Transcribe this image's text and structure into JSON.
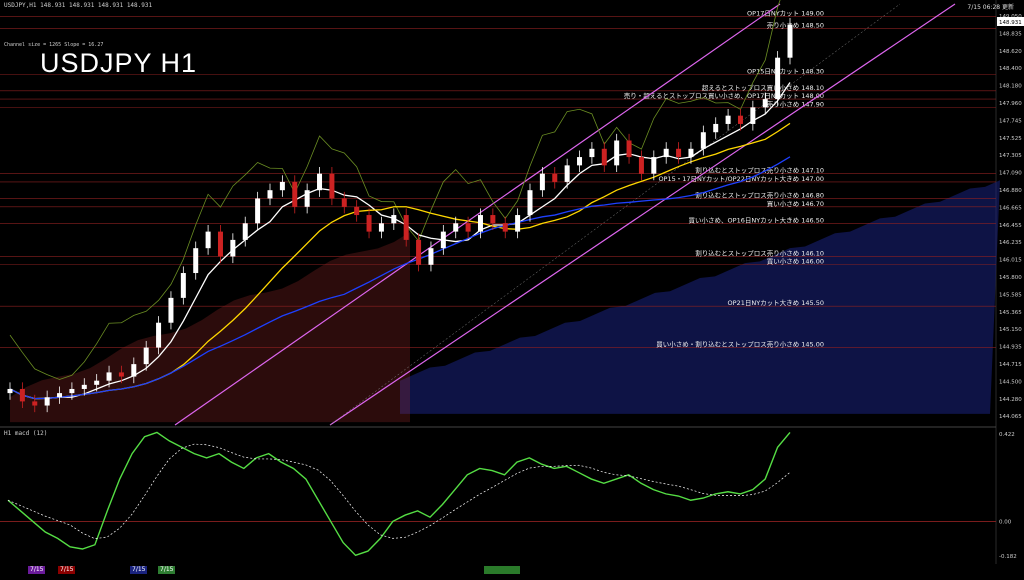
{
  "header": {
    "symbol_line": "USDJPY,H1  148.931 148.931 148.931 148.931",
    "channel_info": "Channel size = 1265 Slope = 16.27",
    "title": "USDJPY H1",
    "timestamp": "7/15 06:28 更新"
  },
  "macd_label": "H1  macd (12)",
  "bottom_tabs": [
    {
      "label": "7/15",
      "color": "#6a1b9a"
    },
    {
      "label": "7/15",
      "color": "#8b0000"
    },
    {
      "label": "7/15",
      "color": "#1a237e"
    },
    {
      "label": "7/15",
      "color": "#2e7d32"
    }
  ],
  "colors": {
    "candle_up": "#ffffff",
    "candle_down": "#cc2222",
    "ma_short": "#ffffff",
    "ma_mid": "#ffd700",
    "ma_long": "#1e40ff",
    "channel": "#dd66ee",
    "ichimoku_span": "#6b8e23",
    "level_line": "#8b2020",
    "macd_main": "#55dd44",
    "macd_signal": "#ffffff",
    "cloud_blue": "#1a237e",
    "cloud_red": "#b03030"
  },
  "chart_data": {
    "type": "line",
    "title": "USDJPY H1",
    "ylim": [
      144.065,
      149.1
    ],
    "price_axis_ticks": [
      "149.050",
      "148.835",
      "148.620",
      "148.400",
      "148.180",
      "147.960",
      "147.745",
      "147.525",
      "147.305",
      "147.090",
      "146.880",
      "146.665",
      "146.455",
      "146.235",
      "146.015",
      "145.800",
      "145.585",
      "145.365",
      "145.150",
      "144.935",
      "144.715",
      "144.500",
      "144.280",
      "144.065"
    ],
    "current_price": "148.931",
    "close": [
      144.5,
      144.35,
      144.3,
      144.4,
      144.45,
      144.5,
      144.55,
      144.6,
      144.7,
      144.65,
      144.8,
      145.0,
      145.3,
      145.6,
      145.9,
      146.2,
      146.4,
      146.1,
      146.3,
      146.5,
      146.8,
      146.9,
      147.0,
      146.7,
      146.9,
      147.1,
      146.8,
      146.7,
      146.6,
      146.4,
      146.5,
      146.6,
      146.3,
      146.0,
      146.2,
      146.4,
      146.5,
      146.4,
      146.6,
      146.5,
      146.4,
      146.6,
      146.9,
      147.1,
      147.0,
      147.2,
      147.3,
      147.4,
      147.2,
      147.5,
      147.3,
      147.1,
      147.3,
      147.4,
      147.3,
      147.4,
      147.6,
      147.7,
      147.8,
      147.7,
      147.9,
      148.0,
      148.5,
      148.9
    ],
    "levels": [
      {
        "price": 149.0,
        "label": "OP17日NYカット 149.00"
      },
      {
        "price": 148.85,
        "label": "売り小さめ 148.50"
      },
      {
        "price": 148.3,
        "label": "OP15日NYカット 148.30"
      },
      {
        "price": 148.1,
        "label": "超えるとストップロス買い小さめ 148.10"
      },
      {
        "price": 148.0,
        "label": "売り・超えるとストップロス買い小さめ、OP17日NYカット 148.00"
      },
      {
        "price": 147.9,
        "label": "売り小さめ 147.90"
      },
      {
        "price": 147.1,
        "label": "割り込むとストップロス売り小さめ 147.10"
      },
      {
        "price": 147.0,
        "label": "OP15・17日NYカット/OP22日NYカット大きめ 147.00"
      },
      {
        "price": 146.8,
        "label": "割り込むとストップロス売り小さめ 146.80"
      },
      {
        "price": 146.7,
        "label": "買い小さめ 146.70"
      },
      {
        "price": 146.5,
        "label": "買い小さめ、OP16日NYカット大きめ 146.50"
      },
      {
        "price": 146.1,
        "label": "割り込むとストップロス売り小さめ 146.10"
      },
      {
        "price": 146.0,
        "label": "買い小さめ 146.00"
      },
      {
        "price": 145.5,
        "label": "OP21日NYカット大きめ 145.50"
      },
      {
        "price": 145.0,
        "label": "買い小さめ・割り込むとストップロス売り小さめ 145.00"
      }
    ],
    "macd_axis": {
      "top": "0.422",
      "zero": "0.00",
      "bottom": "-0.182"
    },
    "macd_main": [
      0.1,
      0.05,
      0.0,
      -0.05,
      -0.08,
      -0.12,
      -0.13,
      -0.11,
      0.05,
      0.2,
      0.32,
      0.4,
      0.42,
      0.38,
      0.35,
      0.32,
      0.3,
      0.32,
      0.28,
      0.25,
      0.3,
      0.32,
      0.28,
      0.25,
      0.2,
      0.1,
      0.0,
      -0.1,
      -0.16,
      -0.14,
      -0.08,
      0.0,
      0.03,
      0.05,
      0.02,
      0.08,
      0.15,
      0.22,
      0.25,
      0.24,
      0.22,
      0.28,
      0.3,
      0.27,
      0.25,
      0.26,
      0.23,
      0.2,
      0.18,
      0.2,
      0.22,
      0.18,
      0.15,
      0.13,
      0.12,
      0.1,
      0.11,
      0.13,
      0.14,
      0.13,
      0.15,
      0.2,
      0.35,
      0.42
    ]
  }
}
